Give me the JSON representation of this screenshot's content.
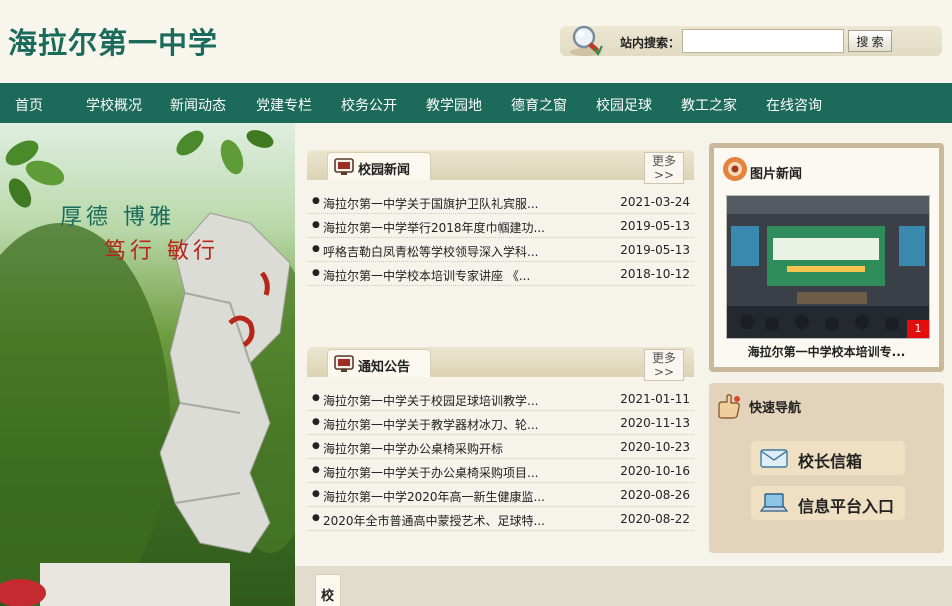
{
  "header": {
    "site_title": "海拉尔第一中学",
    "search_label": "站内搜索：",
    "search_value": "",
    "search_button": "搜 索"
  },
  "nav": [
    "首页",
    "学校概况",
    "新闻动态",
    "党建专栏",
    "校务公开",
    "教学园地",
    "德育之窗",
    "校园足球",
    "教工之家",
    "在线咨询"
  ],
  "hero": {
    "motto_line1": "厚德  博雅",
    "motto_line2": "笃行  敏行"
  },
  "campus_news": {
    "title": "校园新闻",
    "more": "更多>>",
    "items": [
      {
        "title": "海拉尔第一中学关于国旗护卫队礼宾服...",
        "date": "2021-03-24"
      },
      {
        "title": "海拉尔第一中学举行2018年度巾帼建功...",
        "date": "2019-05-13"
      },
      {
        "title": "呼格吉勒白凤青松等学校领导深入学科...",
        "date": "2019-05-13"
      },
      {
        "title": "海拉尔第一中学校本培训专家讲座 《...",
        "date": "2018-10-12"
      }
    ]
  },
  "notices": {
    "title": "通知公告",
    "more": "更多>>",
    "items": [
      {
        "title": "海拉尔第一中学关于校园足球培训教学...",
        "date": "2021-01-11"
      },
      {
        "title": "海拉尔第一中学关于教学器材冰刀、轮...",
        "date": "2020-11-13"
      },
      {
        "title": "海拉尔第一中学办公桌椅采购开标",
        "date": "2020-10-23"
      },
      {
        "title": "海拉尔第一中学关于办公桌椅采购项目...",
        "date": "2020-10-16"
      },
      {
        "title": "海拉尔第一中学2020年高一新生健康监...",
        "date": "2020-08-26"
      },
      {
        "title": "2020年全市普通高中蒙授艺术、足球特...",
        "date": "2020-08-22"
      }
    ]
  },
  "picture_news": {
    "title": "图片新闻",
    "badge": "1",
    "caption": "海拉尔第一中学校本培训专..."
  },
  "quick_nav": {
    "title": "快速导航",
    "buttons": [
      "校长信箱",
      "信息平台入口"
    ]
  },
  "bottom_tab": "校",
  "colors": {
    "brand": "#1a6b5c",
    "nav_bg": "#1c6a5a",
    "accent_red": "#e40d0d"
  }
}
